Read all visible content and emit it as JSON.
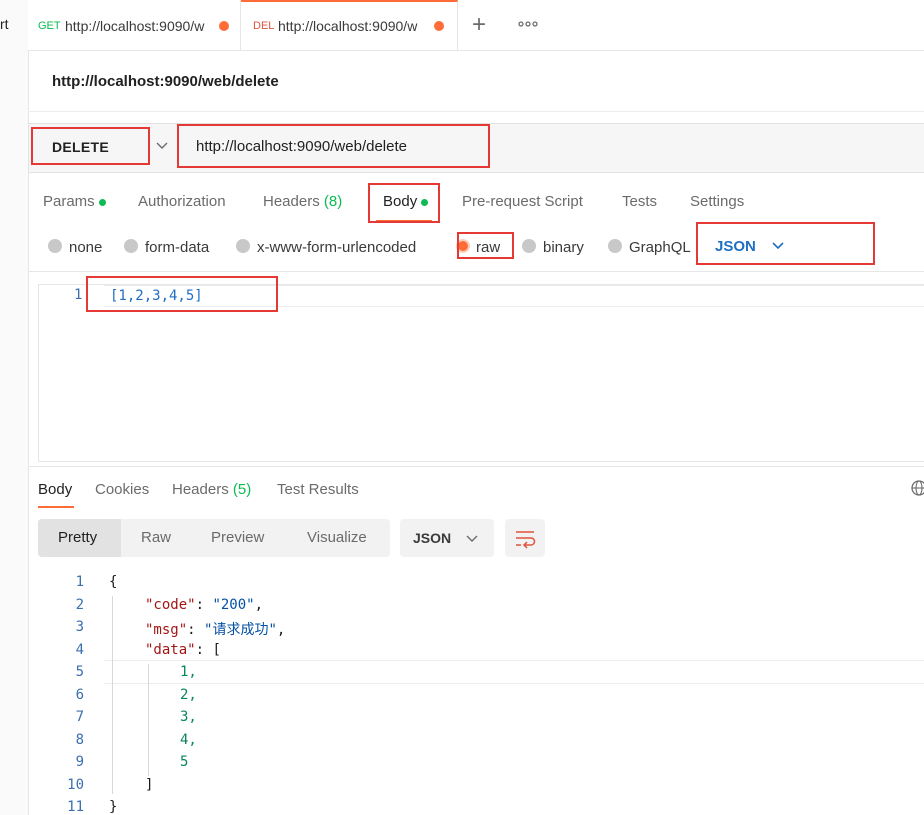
{
  "left_strip_text": "rt",
  "tabs": [
    {
      "method": "GET",
      "method_color": "#0cbb52",
      "url": "http://localhost:9090/w",
      "unsaved": true
    },
    {
      "method": "DEL",
      "method_color": "#e0533d",
      "url": "http://localhost:9090/w",
      "unsaved": true
    }
  ],
  "request": {
    "title": "http://localhost:9090/web/delete",
    "method": "DELETE",
    "url": "http://localhost:9090/web/delete"
  },
  "request_tabs": {
    "params": "Params",
    "authorization": "Authorization",
    "headers": "Headers",
    "headers_count": "(8)",
    "body": "Body",
    "pre_request": "Pre-request Script",
    "tests": "Tests",
    "settings": "Settings"
  },
  "body_types": {
    "none": "none",
    "form_data": "form-data",
    "urlencoded": "x-www-form-urlencoded",
    "raw": "raw",
    "binary": "binary",
    "graphql": "GraphQL",
    "format": "JSON",
    "selected": "raw"
  },
  "request_editor": {
    "line_number": "1",
    "content": "[1,2,3,4,5]"
  },
  "response_tabs": {
    "body": "Body",
    "cookies": "Cookies",
    "headers": "Headers",
    "headers_count": "(5)",
    "test_results": "Test Results"
  },
  "view_modes": {
    "pretty": "Pretty",
    "raw": "Raw",
    "preview": "Preview",
    "visualize": "Visualize",
    "format": "JSON"
  },
  "response": {
    "line_numbers": [
      "1",
      "2",
      "3",
      "4",
      "5",
      "6",
      "7",
      "8",
      "9",
      "10",
      "11"
    ],
    "open_brace": "{",
    "close_brace": "}",
    "code_key": "\"code\"",
    "code_value": "\"200\"",
    "msg_key": "\"msg\"",
    "msg_value": "\"请求成功\"",
    "data_key": "\"data\"",
    "open_bracket": "[",
    "close_bracket": "]",
    "items": [
      "1,",
      "2,",
      "3,",
      "4,",
      "5"
    ]
  },
  "colors": {
    "accent": "#ff6c37",
    "highlight_box": "#e53935",
    "active_dot": "#0cbb52",
    "link_blue": "#1f6fc5"
  }
}
